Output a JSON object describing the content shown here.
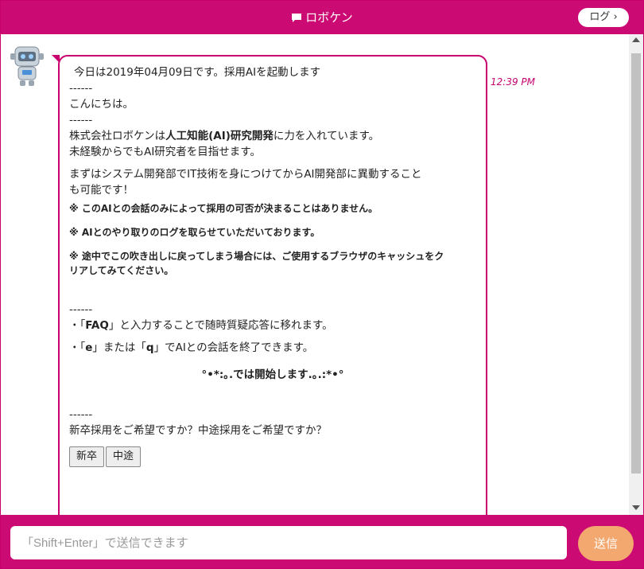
{
  "header": {
    "title": "ロボケン",
    "log_button": "ログ"
  },
  "message": {
    "time": "12:39 PM",
    "date_line": "今日は2019年04月09日です。採用AIを起動します",
    "sep1": "------",
    "greeting": "こんにちは。",
    "sep2": "------",
    "company_pre": "株式会社ロボケンは",
    "company_bold": "人工知能(AI)研究開発",
    "company_post": "に力を入れています。",
    "inexperienced": "未経験からでもAI研究者を目指せます。",
    "path_line1": "まずはシステム開発部でIT技術を身につけてからAI開発部に異動すること",
    "path_line2": "も可能です！",
    "notice1": "※ このAIとの会話のみによって採用の可否が決まることはありません。",
    "notice2": "※ AIとのやり取りのログを取らせていただいております。",
    "notice3_line1": "※ 途中でこの吹き出しに戻ってしまう場合には、ご使用するブラウザのキャッシュをク",
    "notice3_line2": "リアしてみてください。",
    "sep3": "------",
    "faq_pre": "・「",
    "faq_bold": "FAQ",
    "faq_post": "」と入力することで随時質疑応答に移れます。",
    "exit_pre": "・「",
    "exit_e": "e",
    "exit_mid": "」または「",
    "exit_q": "q",
    "exit_post": "」でAIとの会話を終了できます。",
    "start_line": "°•*:｡.では開始します.｡.:*•°",
    "sep4": "------",
    "question": "新卒採用をご希望ですか？中途採用をご希望ですか？",
    "choices": [
      "新卒",
      "中途"
    ]
  },
  "footer": {
    "input_placeholder": "「Shift+Enter」で送信できます",
    "send_button": "送信"
  }
}
